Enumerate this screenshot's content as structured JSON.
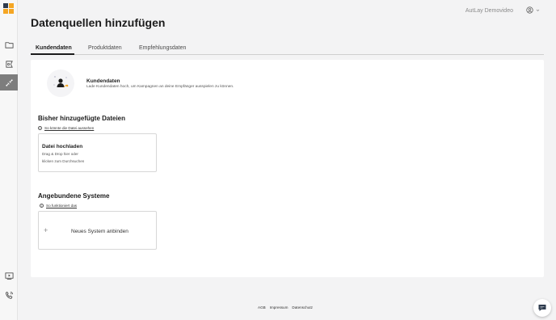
{
  "app": {
    "page_title": "Datenquellen hinzufügen"
  },
  "header": {
    "demo_label": "AutLay Demovideo",
    "account_icon": "user-circle-icon",
    "chevron_icon": "chevron-down-icon"
  },
  "sidebar": {
    "icons": [
      "folder-icon",
      "campaign-icon",
      "connect-icon",
      "video-icon",
      "phone-icon"
    ],
    "active_index": 2
  },
  "tabs": [
    {
      "label": "Kundendaten",
      "active": true
    },
    {
      "label": "Produktdaten",
      "active": false
    },
    {
      "label": "Empfehlungsdaten",
      "active": false
    }
  ],
  "hero": {
    "title": "Kundendaten",
    "subtitle": "Lade Kundendaten hoch, um Kampagnen an deine Empfänger ausspielen zu können."
  },
  "uploaded": {
    "title": "Bisher hinzugefügte Dateien",
    "help_link": "So könnte die Datei aussehen",
    "upload_title": "Datei hochladen",
    "upload_line1": "Drag & Drop hier oder",
    "upload_line2": "klicken zum Durchsuchen"
  },
  "systems": {
    "title": "Angebundene Systeme",
    "help_link": "So funktioniert das",
    "add_label": "Neues System anbinden",
    "add_symbol": "+"
  },
  "footer": {
    "links": [
      "AGB",
      "Impressum",
      "Datenschutz"
    ]
  },
  "colors": {
    "accent": "#1c1c1c",
    "logo_orange": "#f5a623",
    "logo_dark": "#2e3b4e",
    "sidebar_active": "#7d7d7d"
  }
}
